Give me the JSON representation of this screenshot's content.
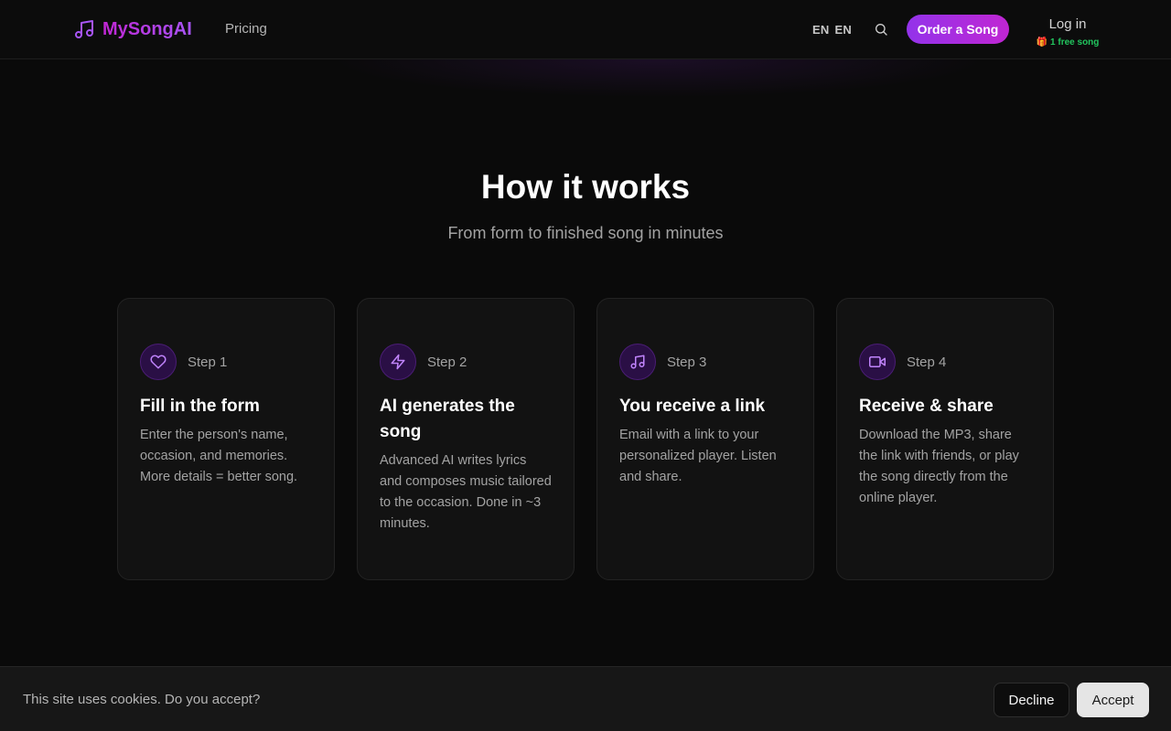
{
  "header": {
    "logo_text": "MySongAI",
    "nav_pricing": "Pricing",
    "lang_primary": "EN",
    "lang_secondary": "EN",
    "order_button": "Order a Song",
    "login_label": "Log in",
    "free_song_badge": "1 free song",
    "gift_icon": "🎁"
  },
  "hero": {
    "title": "How it works",
    "subtitle": "From form to finished song in minutes"
  },
  "steps": [
    {
      "icon": "heart-icon",
      "step": "Step 1",
      "title": "Fill in the form",
      "description": "Enter the person's name, occasion, and memories. More details = better song."
    },
    {
      "icon": "lightning-icon",
      "step": "Step 2",
      "title": "AI generates the song",
      "description": "Advanced AI writes lyrics and composes music tailored to the occasion. Done in ~3 minutes."
    },
    {
      "icon": "music-note-icon",
      "step": "Step 3",
      "title": "You receive a link",
      "description": "Email with a link to your personalized player. Listen and share."
    },
    {
      "icon": "video-icon",
      "step": "Step 4",
      "title": "Receive & share",
      "description": "Download the MP3, share the link with friends, or play the song directly from the online player."
    }
  ],
  "cookie": {
    "message": "This site uses cookies. Do you accept?",
    "decline": "Decline",
    "accept": "Accept"
  },
  "colors": {
    "accent_purple": "#a855f7",
    "accent_magenta": "#c026d3",
    "free_badge_green": "#22c55e",
    "background": "#0a0a0a",
    "card_background": "#121212"
  }
}
